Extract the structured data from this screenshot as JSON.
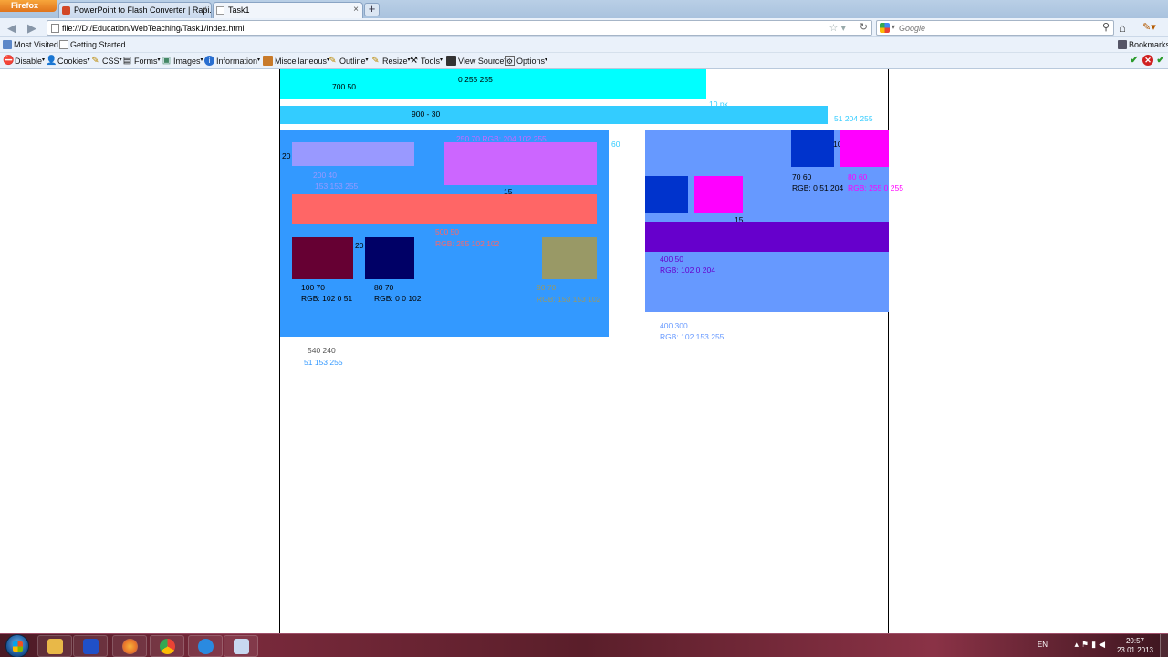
{
  "browser": {
    "menu_button": "Firefox",
    "tabs": [
      {
        "title": "PowerPoint to Flash Converter | Rapi..."
      },
      {
        "title": "Task1"
      }
    ],
    "url": "file:///D:/Education/WebTeaching/Task1/index.html",
    "search_placeholder": "Google",
    "bookmarks": [
      {
        "label": "Most Visited"
      },
      {
        "label": "Getting Started"
      }
    ],
    "bookmarks_menu": "Bookmarks",
    "devbar": [
      {
        "label": "Disable",
        "icon": "no-entry-icon"
      },
      {
        "label": "Cookies",
        "icon": "person-icon"
      },
      {
        "label": "CSS",
        "icon": "pencil-icon"
      },
      {
        "label": "Forms",
        "icon": "form-icon"
      },
      {
        "label": "Images",
        "icon": "image-icon"
      },
      {
        "label": "Information",
        "icon": "info-icon"
      },
      {
        "label": "Miscellaneous",
        "icon": "toolbox-icon"
      },
      {
        "label": "Outline",
        "icon": "pencil-icon"
      },
      {
        "label": "Resize",
        "icon": "pencil-icon"
      },
      {
        "label": "Tools",
        "icon": "tools-icon"
      },
      {
        "label": "View Source",
        "icon": "source-icon"
      },
      {
        "label": "Options",
        "icon": "options-icon"
      }
    ]
  },
  "page": {
    "labels": {
      "top_bar_rgb": "0 255 255",
      "top_bar_size": "700 50",
      "gap": "10 px",
      "second_bar_size": "900 - 30",
      "second_bar_rgb": "51 204 255",
      "left_margin": "20",
      "small_box_size": "200   40",
      "small_box_rgb": "153 153 255",
      "pink_box_info": "250 70 RGB: 204 102 255",
      "sixty": "60",
      "fifteen_left": "15",
      "red_bar_size": "500 50",
      "red_bar_rgb": "RGB: 255 102 102",
      "twenty_mid": "20",
      "maroon_size": "100 70",
      "maroon_rgb": "RGB: 102 0 51",
      "navy_size": "80 70",
      "navy_rgb": "RGB: 0 0 102",
      "olive_size": "90 70",
      "olive_rgb": "RGB: 153 153 102",
      "left_panel_size": "540 240",
      "left_panel_rgb": "51 153 255",
      "ten_right": "10",
      "blue_box_size": "70 60",
      "blue_box_rgb": "RGB: 0 51 204",
      "magenta_size": "80 60",
      "magenta_rgb": "RGB: 255 0 255",
      "fifteen_right": "15",
      "purple_size": "400 50",
      "purple_rgb": "RGB: 102 0 204",
      "right_panel_size": "400 300",
      "right_panel_rgb": "RGB: 102 153 255"
    },
    "colors": {
      "cyan": "#00ffff",
      "sky": "#33ccff",
      "left_panel": "#3399ff",
      "lavender": "#9999ff",
      "pink": "#cc66ff",
      "red": "#ff6666",
      "maroon": "#660033",
      "navy": "#000066",
      "olive": "#999966",
      "right_panel": "#6699ff",
      "blue": "#0033cc",
      "magenta": "#ff00ff",
      "purple": "#6600cc"
    }
  },
  "taskbar": {
    "apps": [
      {
        "name": "explorer",
        "color": "#e8b848"
      },
      {
        "name": "app-blue",
        "color": "#2050c8"
      },
      {
        "name": "firefox",
        "color": "#e8722a"
      },
      {
        "name": "chrome",
        "color": "#3a9a4a"
      },
      {
        "name": "internet-explorer",
        "color": "#2a8ae0"
      },
      {
        "name": "app-window",
        "color": "#c8d8f0"
      }
    ],
    "lang": "EN",
    "time": "20:57",
    "date": "23.01.2013"
  }
}
